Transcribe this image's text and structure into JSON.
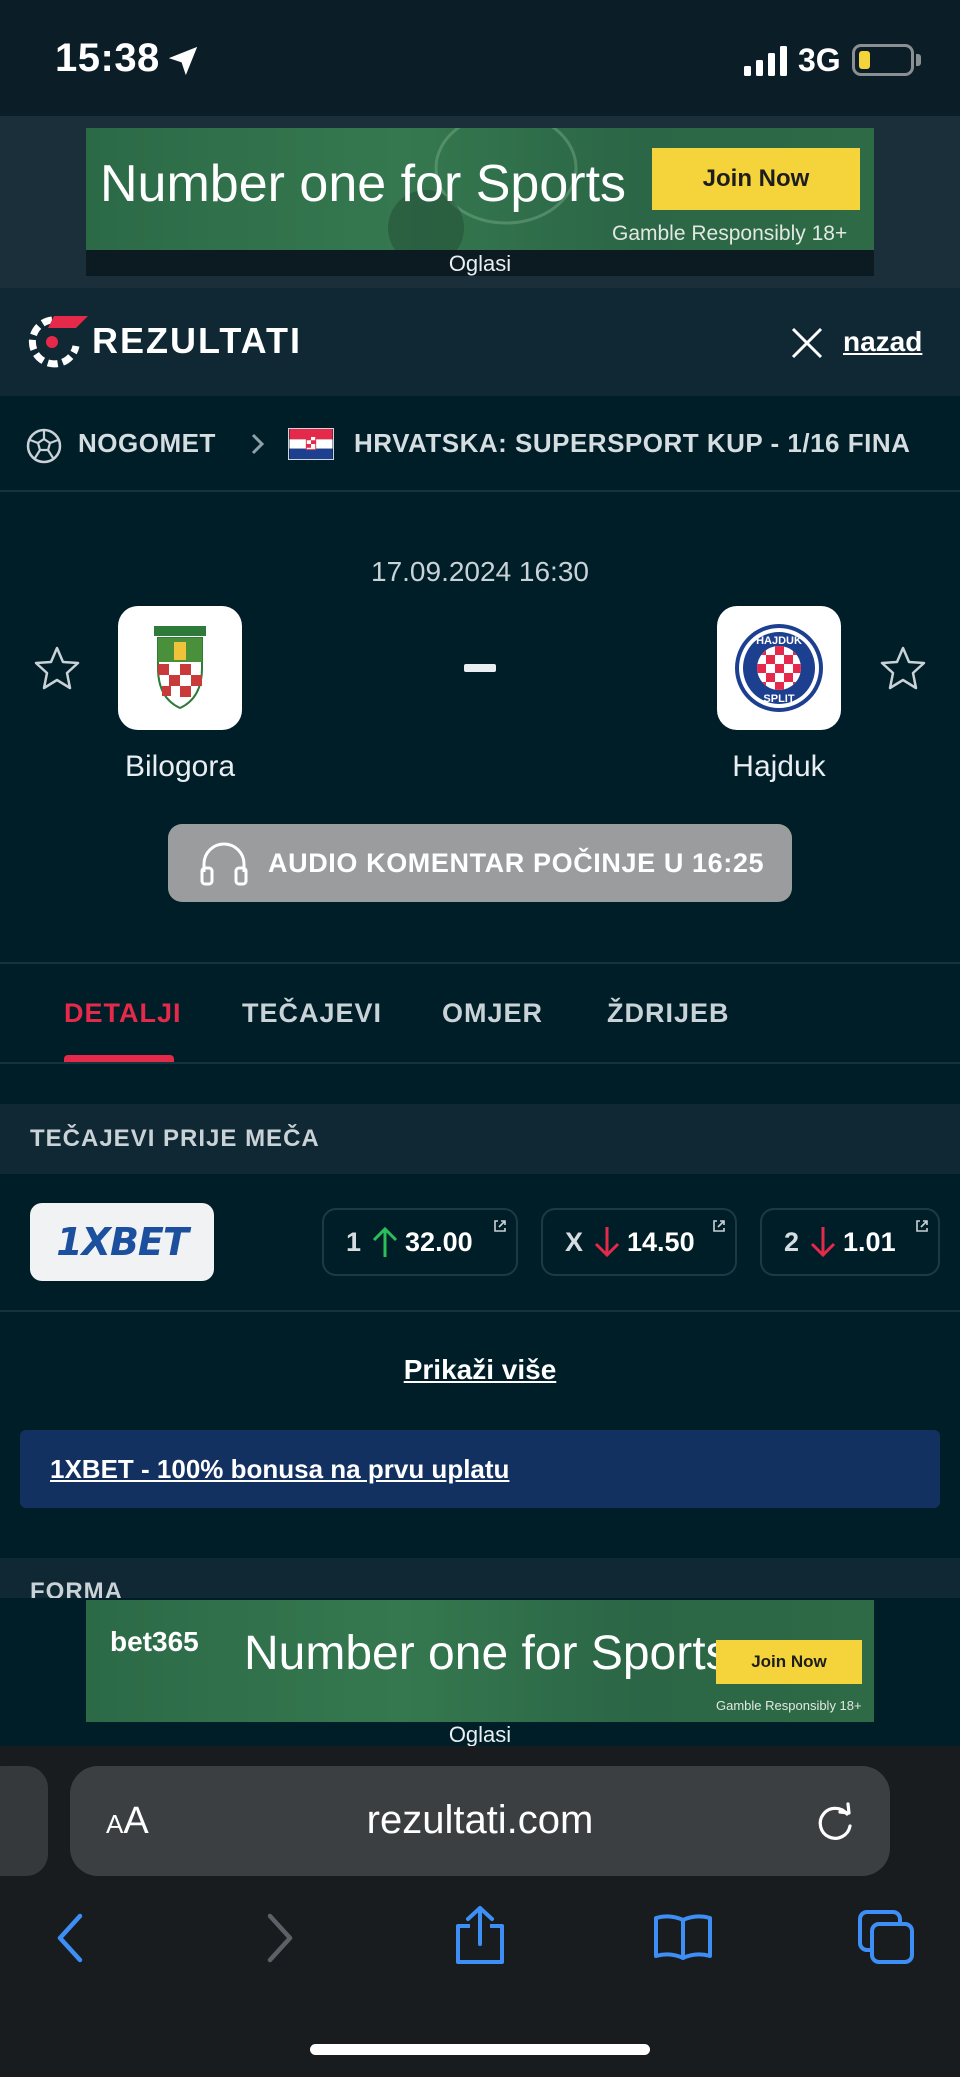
{
  "status_bar": {
    "time": "15:38",
    "network": "3G"
  },
  "top_ad": {
    "headline": "Number one for Sports",
    "cta": "Join Now",
    "legal": "Gamble Responsibly  18+",
    "caption": "Oglasi"
  },
  "header": {
    "brand": "REZULTATI",
    "back_label": "nazad"
  },
  "breadcrumb": {
    "sport": "NOGOMET",
    "league": "HRVATSKA: SUPERSPORT KUP - 1/16 FINA"
  },
  "match": {
    "datetime": "17.09.2024 16:30",
    "home_team": "Bilogora",
    "away_team": "Hajduk",
    "away_logo_text_top": "HAJDUK",
    "away_logo_text_bottom": "SPLIT"
  },
  "audio": {
    "label": "AUDIO KOMENTAR POČINJE U 16:25"
  },
  "tabs": [
    {
      "label": "DETALJI",
      "active": true
    },
    {
      "label": "TEČAJEVI",
      "active": false
    },
    {
      "label": "OMJER",
      "active": false
    },
    {
      "label": "ŽDRIJEB",
      "active": false
    }
  ],
  "odds": {
    "section_title": "TEČAJEVI PRIJE MEČA",
    "bookmaker": "1XBET",
    "items": [
      {
        "label": "1",
        "value": "32.00",
        "trend": "up",
        "trend_color": "#2bbf5a"
      },
      {
        "label": "X",
        "value": "14.50",
        "trend": "down",
        "trend_color": "#e5294a"
      },
      {
        "label": "2",
        "value": "1.01",
        "trend": "down",
        "trend_color": "#e5294a"
      }
    ],
    "show_more": "Prikaži više",
    "promo": "1XBET - 100% bonusa na prvu uplatu"
  },
  "form": {
    "title": "FORMA"
  },
  "bottom_ad": {
    "brand": "bet365",
    "headline": "Number one for Sports",
    "cta": "Join Now",
    "legal": "Gamble Responsibly  18+",
    "caption": "Oglasi"
  },
  "browser": {
    "aa_big": "A",
    "aa_small": "A",
    "url": "rezultati.com"
  },
  "colors": {
    "accent": "#e5294a",
    "background": "#001e28",
    "header": "#0f2833",
    "promo": "#133160"
  }
}
